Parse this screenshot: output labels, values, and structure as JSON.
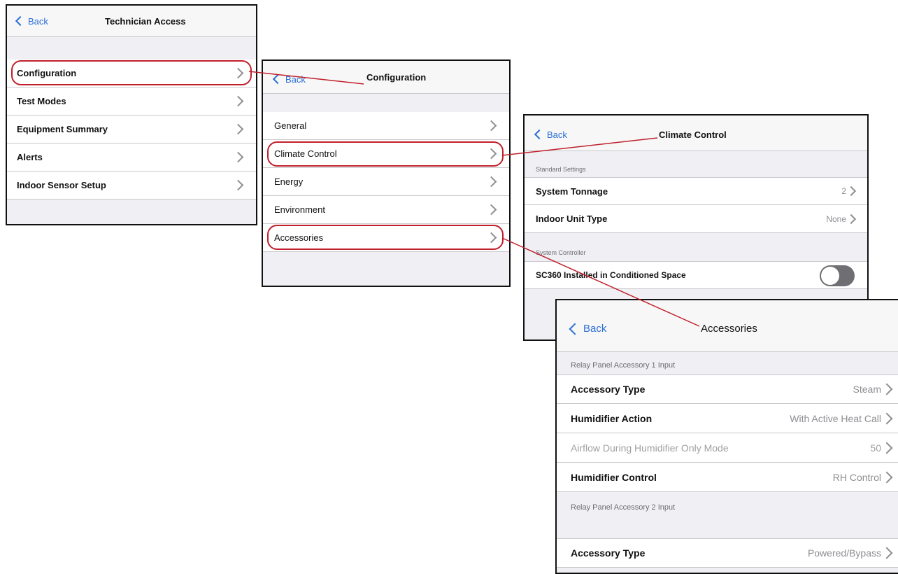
{
  "colors": {
    "accent": "#2b6fd6",
    "highlight": "#c0202c",
    "toggle_off": "#6e6e73"
  },
  "icons": {
    "back": "chevron-left-icon",
    "disclosure": "chevron-right-icon"
  },
  "screen1": {
    "back_label": "Back",
    "title": "Technician Access",
    "items": [
      "Configuration",
      "Test Modes",
      "Equipment Summary",
      "Alerts",
      "Indoor Sensor Setup"
    ]
  },
  "screen2": {
    "back_label": "Back",
    "title": "Configuration",
    "items": [
      "General",
      "Climate Control",
      "Energy",
      "Environment",
      "Accessories"
    ]
  },
  "screen3": {
    "back_label": "Back",
    "title": "Climate Control",
    "section1": "Standard Settings",
    "rows": [
      {
        "label": "System Tonnage",
        "value": "2"
      },
      {
        "label": "Indoor Unit Type",
        "value": "None"
      }
    ],
    "section2": "System Controller",
    "toggle_label": "SC360 Installed in Conditioned Space",
    "toggle_on": false
  },
  "screen4": {
    "back_label": "Back",
    "title": "Accessories",
    "section1": "Relay Panel Accessory 1 Input",
    "rows": [
      {
        "label": "Accessory Type",
        "value": "Steam"
      },
      {
        "label": "Humidifier Action",
        "value": "With Active Heat Call"
      },
      {
        "label": "Airflow During Humidifier Only Mode",
        "value": "50"
      },
      {
        "label": "Humidifier Control",
        "value": "RH Control"
      }
    ],
    "section2": "Relay Panel Accessory 2 Input",
    "rows2": [
      {
        "label": "Accessory Type",
        "value": "Powered/Bypass"
      }
    ]
  }
}
